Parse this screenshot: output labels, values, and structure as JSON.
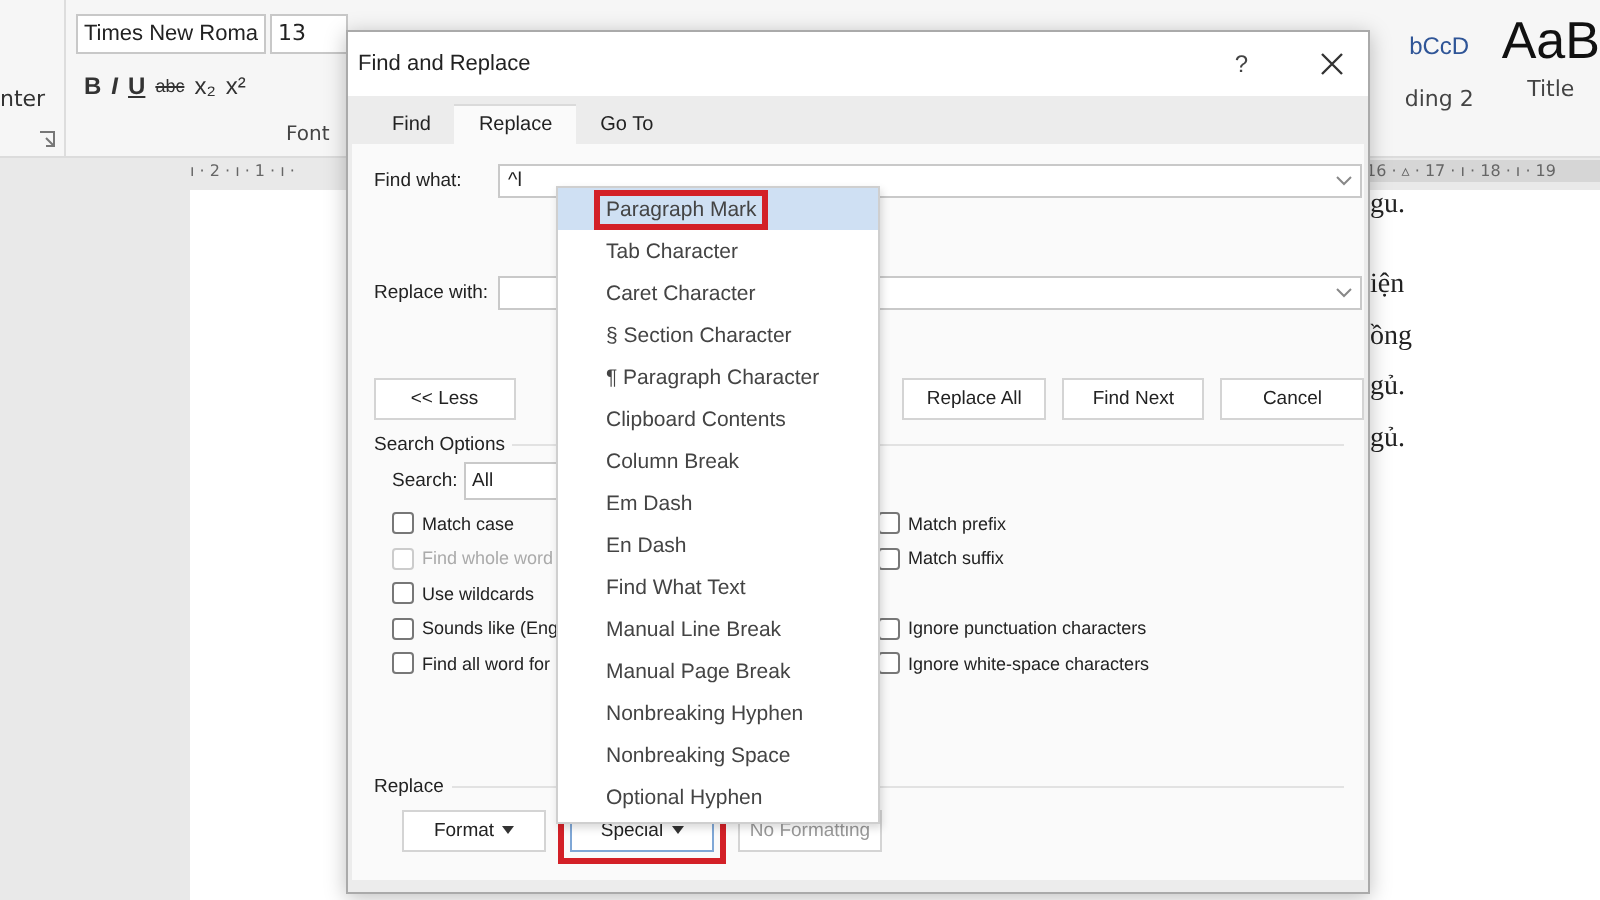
{
  "app": {
    "ribbon": {
      "group_label_left": "nter",
      "font_group": {
        "font_name": "Times New Roma",
        "font_size": "13",
        "format_buttons": [
          "B",
          "I",
          "U",
          "abc",
          "x₂",
          "x²"
        ],
        "label": "Font"
      },
      "styles": [
        {
          "kind": "heading",
          "preview": "bCcD",
          "name": "ding 2"
        },
        {
          "kind": "title",
          "preview": "AaB",
          "name": "Title"
        }
      ]
    },
    "ruler_left": "ı · 2 · ı · 1 · ı ·",
    "ruler_right": "16 · ▵ · 17 · ı · 18 · ı · 19",
    "document_lines": [
      "gu.",
      "iện",
      "ồng",
      "gủ.",
      "gủ."
    ]
  },
  "dialog": {
    "title": "Find and Replace",
    "help": "?",
    "tabs": [
      {
        "label": "Find",
        "selected": false
      },
      {
        "label": "Replace",
        "selected": true
      },
      {
        "label": "Go To",
        "selected": false
      }
    ],
    "find_what": {
      "label": "Find what:",
      "value": "^l"
    },
    "replace_with": {
      "label": "Replace with:"
    },
    "less_button": "<< Less",
    "action_buttons": [
      "Replace All",
      "Find Next",
      "Cancel"
    ],
    "search_options": {
      "label": "Search Options",
      "search_label": "Search:",
      "search_value": "All",
      "left_options": [
        {
          "label": "Match case",
          "checked": false,
          "disabled": false
        },
        {
          "label": "Find whole word",
          "checked": false,
          "disabled": true
        },
        {
          "label": "Use wildcards",
          "checked": false,
          "disabled": false
        },
        {
          "label": "Sounds like (Eng",
          "checked": false,
          "disabled": false
        },
        {
          "label": "Find all word for",
          "checked": false,
          "disabled": false
        }
      ],
      "right_options": [
        {
          "label": "Match prefix",
          "checked": false,
          "disabled": false
        },
        {
          "label": "Match suffix",
          "checked": false,
          "disabled": false
        },
        {
          "label": "Ignore punctuation characters",
          "checked": false,
          "disabled": false
        },
        {
          "label": "Ignore white-space characters",
          "checked": false,
          "disabled": false
        }
      ]
    },
    "replace_section": {
      "label": "Replace",
      "buttons": [
        {
          "label": "Format",
          "kind": "dropdown",
          "disabled": false,
          "highlighted": false
        },
        {
          "label": "Special",
          "kind": "dropdown",
          "disabled": false,
          "highlighted": true
        },
        {
          "label": "No Formatting",
          "kind": "plain",
          "disabled": true,
          "highlighted": false
        }
      ]
    },
    "special_menu": [
      {
        "label": "Paragraph Mark",
        "selected": true,
        "highlighted": true
      },
      {
        "label": "Tab Character",
        "selected": false,
        "highlighted": false
      },
      {
        "label": "Caret Character",
        "selected": false,
        "highlighted": false
      },
      {
        "label": "§ Section Character",
        "selected": false,
        "highlighted": false
      },
      {
        "label": "¶ Paragraph Character",
        "selected": false,
        "highlighted": false
      },
      {
        "label": "Clipboard Contents",
        "selected": false,
        "highlighted": false
      },
      {
        "label": "Column Break",
        "selected": false,
        "highlighted": false
      },
      {
        "label": "Em Dash",
        "selected": false,
        "highlighted": false
      },
      {
        "label": "En Dash",
        "selected": false,
        "highlighted": false
      },
      {
        "label": "Find What Text",
        "selected": false,
        "highlighted": false
      },
      {
        "label": "Manual Line Break",
        "selected": false,
        "highlighted": false
      },
      {
        "label": "Manual Page Break",
        "selected": false,
        "highlighted": false
      },
      {
        "label": "Nonbreaking Hyphen",
        "selected": false,
        "highlighted": false
      },
      {
        "label": "Nonbreaking Space",
        "selected": false,
        "highlighted": false
      },
      {
        "label": "Optional Hyphen",
        "selected": false,
        "highlighted": false
      }
    ]
  }
}
